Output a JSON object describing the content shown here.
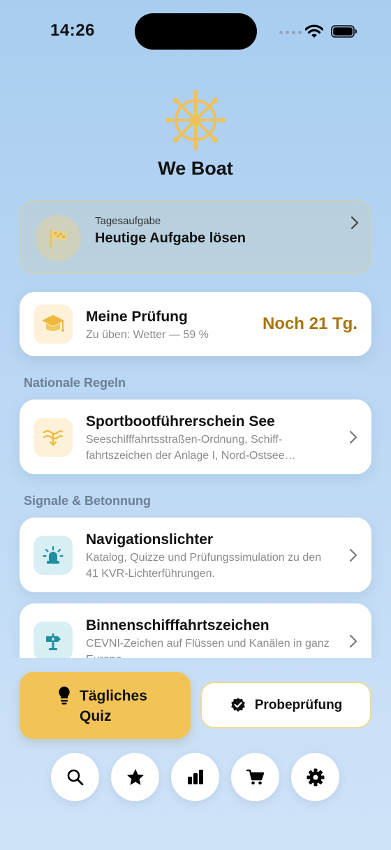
{
  "status": {
    "time": "14:26"
  },
  "app": {
    "title": "We Boat"
  },
  "daily_task": {
    "kicker": "Tagesaufgabe",
    "title": "Heutige Aufgabe lösen"
  },
  "exam": {
    "title": "Meine Prüfung",
    "subtitle": "Zu üben: Wetter — 59 %",
    "countdown": "Noch 21 Tg."
  },
  "sections": [
    {
      "label": "Nationale Regeln",
      "items": [
        {
          "title": "Sportbootführerschein See",
          "subtitle": "Seeschifffahrtsstraßen-Ordnung, Schiff­fahrtszeichen der Anlage I, Nord-Ostsee…"
        }
      ]
    },
    {
      "label": "Signale & Betonnung",
      "items": [
        {
          "title": "Navigationslichter",
          "subtitle": "Katalog, Quizze und Prüfungssimulation zu den 41 KVR-Lichterführungen."
        },
        {
          "title": "Binnenschifffahrtszeichen",
          "subtitle": "CEVNI-Zeichen auf Flüssen und Kanälen in ganz Europa."
        }
      ]
    }
  ],
  "actions": {
    "daily_quiz": "Tägliches Quiz",
    "mock_exam": "Probeprüfung"
  },
  "tabs": [
    "search-icon",
    "star-icon",
    "stats-icon",
    "cart-icon",
    "settings-icon"
  ],
  "colors": {
    "accent": "#f2c357",
    "countdown": "#a87512",
    "logo": "#eec15a"
  }
}
